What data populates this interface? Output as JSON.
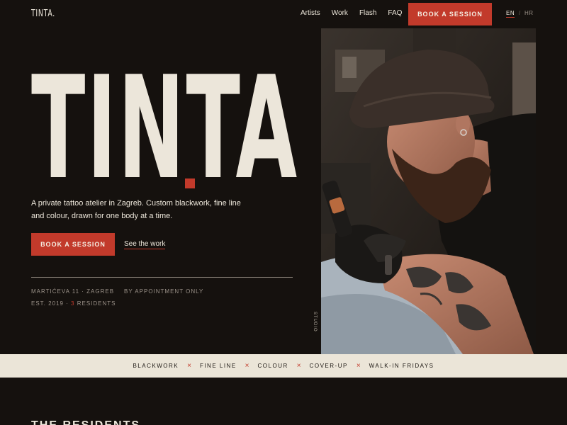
{
  "nav": {
    "logo": "TINTA.",
    "links": [
      "Artists",
      "Work",
      "Flash",
      "FAQ"
    ],
    "book_label": "BOOK A SESSION",
    "lang": {
      "active": "EN",
      "separator": "/",
      "other": "HR"
    }
  },
  "hero": {
    "title": "TINTA",
    "tagline": "A private tattoo atelier in Zagreb. Custom blackwork, fine line and colour, drawn for one body at a time.",
    "book_label": "BOOK A SESSION",
    "work_label": "See the work",
    "address": "MARTIĆEVA 11 · ZAGREB",
    "appointment": "BY APPOINTMENT ONLY",
    "established_prefix": "EST. 2019 ·",
    "residents_count": "3",
    "residents_label": "RESIDENTS",
    "photo_caption": "STUDIO"
  },
  "ticker": {
    "items": [
      "BLACKWORK",
      "FINE LINE",
      "COLOUR",
      "COVER-UP",
      "WALK-IN FRIDAYS"
    ],
    "separator": "×"
  },
  "residents": {
    "title": "THE RESIDENTS"
  },
  "colors": {
    "accent": "#c23a2b",
    "background": "#15110e",
    "cream": "#ebe5d8"
  }
}
